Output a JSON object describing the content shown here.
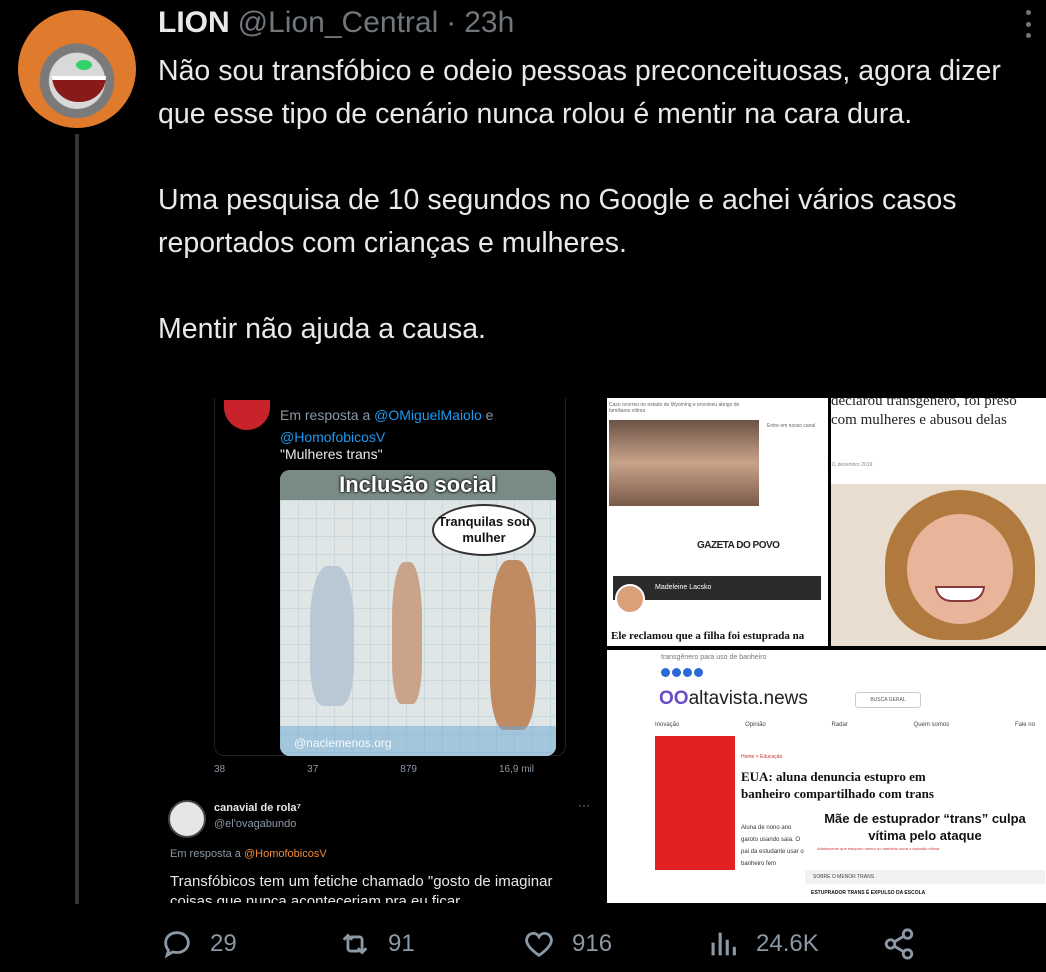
{
  "tweet": {
    "name": "LION",
    "handle": "@Lion_Central",
    "separator": "·",
    "time": "23h",
    "text": "Não sou transfóbico e odeio pessoas preconceituosas, agora dizer que esse tipo de cenário nunca rolou é mentir na cara dura.\n\nUma pesquisa de 10 segundos no Google e achei vários casos reportados com crianças e mulheres.\n\nMentir não ajuda a causa."
  },
  "media": {
    "embedded_tweet": {
      "reply_prefix": "Em resposta a",
      "reply_to_1": "@OMiguelMaiolo",
      "reply_and": "e",
      "reply_to_2": "@HomofobicosV",
      "quote": "\"Mulheres trans\"",
      "meme_title": "Inclusão social",
      "meme_bubble": "Tranquilas sou mulher",
      "meme_watermark": "@naciemenos.org",
      "metrics": {
        "replies": "38",
        "retweets": "37",
        "likes": "879",
        "views": "16,9 mil"
      },
      "reply2": {
        "name": "canavial de rola⁷",
        "handle": "@el'ovagabundo",
        "reply_prefix": "Em resposta a",
        "reply_to": "@HomofobicosV",
        "text": "Transfóbicos tem um fetiche chamado \"gosto de imaginar coisas que nunca aconteceriam pra eu ficar"
      }
    },
    "gazeta": {
      "caption": "Caso ocorreu no estado de Wyoming e envolveu abrigo de familiares vítima",
      "sidebox": "Entre em nosso canal",
      "brand": "GAZETA DO POVO",
      "author": "Madeleine Lacsko",
      "headline": "Ele reclamou que a filha foi estuprada na"
    },
    "photo_article": {
      "headline": "declarou transgênero, foi preso com mulheres e abusou delas",
      "date": "11 dezembro 2019"
    },
    "altavista": {
      "top_note": "transgênero para uso de banheiro",
      "logo_prefix": "OO",
      "logo": "altavista.news",
      "search": "BUSCA GERAL",
      "nav": [
        "Inovação",
        "Opinião",
        "Radar",
        "Quem somos",
        "Fale no"
      ],
      "crumb": "Home > Educação",
      "title": "EUA: aluna denuncia estupro em banheiro compartilhado com trans",
      "body": "Aluna de nono ano garoto usando saia. O pai da estudante usar o banheiro fem",
      "overlay_title": "Mãe de estuprador “trans” culpa vítima pelo ataque",
      "overlay_sub": "Adolescente que estuprou menor no banheiro acha o episódio vítima",
      "bottom_bar": "SOBRE O MENOR TRANS",
      "bottom_bar2": "ESTUPRADOR TRANS É EXPULSO DA ESCOLA"
    }
  },
  "actions": {
    "replies": "29",
    "retweets": "91",
    "likes": "916",
    "views": "24.6K"
  },
  "icons": [
    "reply-icon",
    "retweet-icon",
    "like-icon",
    "views-icon",
    "share-icon",
    "more-icon"
  ]
}
